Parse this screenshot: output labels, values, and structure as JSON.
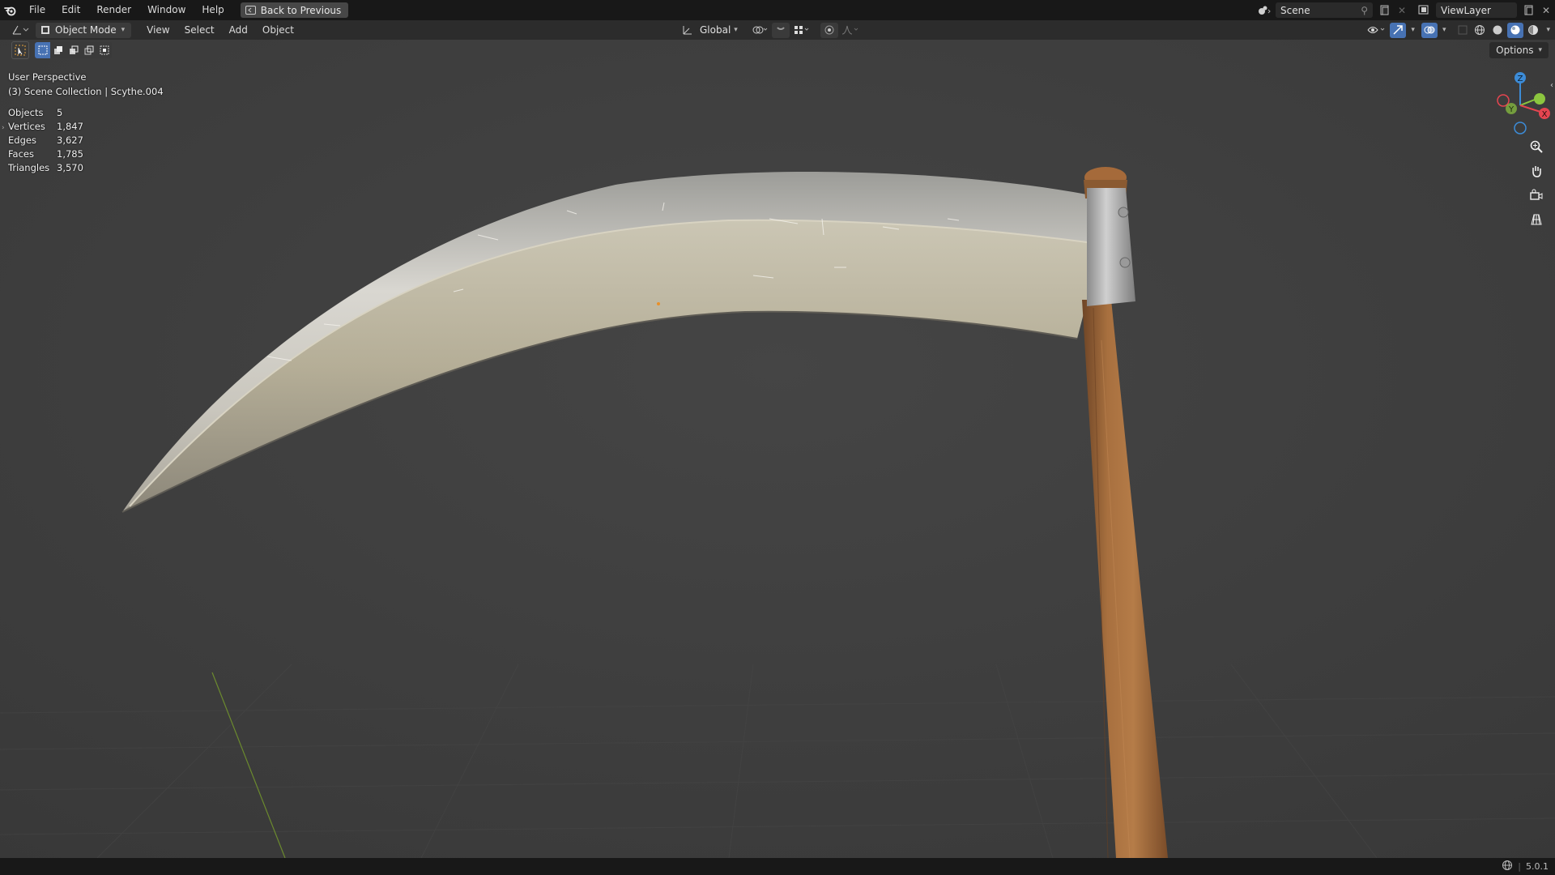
{
  "topbar": {
    "menus": [
      "File",
      "Edit",
      "Render",
      "Window",
      "Help"
    ],
    "back_button": "Back to Previous",
    "scene_name": "Scene",
    "view_layer": "ViewLayer"
  },
  "header": {
    "mode": "Object Mode",
    "menus": [
      "View",
      "Select",
      "Add",
      "Object"
    ],
    "transform_orientation": "Global",
    "options_label": "Options"
  },
  "viewport": {
    "perspective": "User Perspective",
    "collection_line": "(3) Scene Collection | Scythe.004",
    "stats": [
      {
        "label": "Objects",
        "value": "5"
      },
      {
        "label": "Vertices",
        "value": "1,847"
      },
      {
        "label": "Edges",
        "value": "3,627"
      },
      {
        "label": "Faces",
        "value": "1,785"
      },
      {
        "label": "Triangles",
        "value": "3,570"
      }
    ],
    "gizmo_axes": {
      "x": "X",
      "y": "Y",
      "z": "Z"
    }
  },
  "statusbar": {
    "version": "5.0.1"
  },
  "colors": {
    "accent": "#4772b3",
    "axis_x": "#e54550",
    "axis_y": "#8cc63f",
    "axis_z": "#3c8cd8"
  },
  "icons": {
    "logo": "blender-logo-icon",
    "zoom": "zoom-icon",
    "pan": "hand-icon",
    "camera": "camera-icon",
    "ortho": "grid-icon"
  }
}
